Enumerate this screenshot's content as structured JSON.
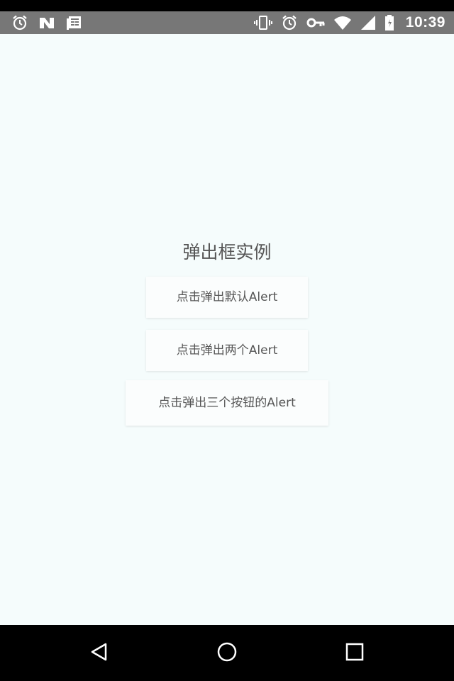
{
  "status_bar": {
    "time": "10:39",
    "left_icons": [
      "alarm-icon",
      "n-notification-icon",
      "news-icon"
    ],
    "right_icons": [
      "vibrate-icon",
      "alarm-icon",
      "key-icon",
      "wifi-icon",
      "signal-icon",
      "battery-icon"
    ]
  },
  "main": {
    "title": "弹出框实例",
    "buttons": [
      {
        "label": "点击弹出默认Alert"
      },
      {
        "label": "点击弹出两个Alert"
      },
      {
        "label": "点击弹出三个按钮的Alert"
      }
    ]
  },
  "nav_bar": {
    "icons": [
      "back-icon",
      "home-icon",
      "recents-icon"
    ]
  },
  "colors": {
    "background": "#f5fcfc",
    "status_bar": "#777777",
    "text": "#555555",
    "nav_bar": "#000000"
  }
}
